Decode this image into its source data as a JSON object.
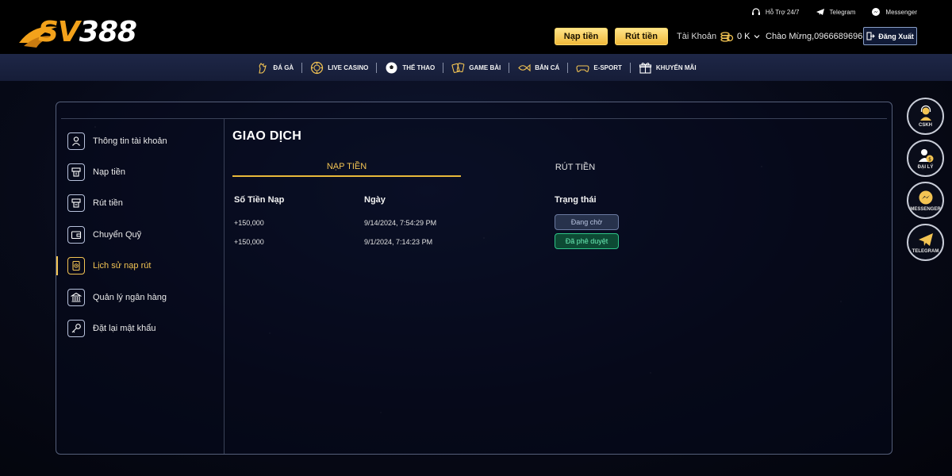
{
  "logo": {
    "text_sv": "SV",
    "text_num": "388"
  },
  "header": {
    "support_label": "Hỗ Trợ 24/7",
    "telegram_label": "Telegram",
    "messenger_label": "Messenger",
    "deposit_button": "Nạp tiền",
    "withdraw_button": "Rút tiền",
    "account_label": "Tài Khoản",
    "balance": "0 K",
    "welcome": "Chào Mừng,0966689696",
    "logout_button": "Đăng Xuất"
  },
  "nav": {
    "items": [
      {
        "label": "ĐÁ GÀ",
        "icon": "rooster-icon"
      },
      {
        "label": "LIVE CASINO",
        "icon": "chip-icon"
      },
      {
        "label": "THỂ THAO",
        "icon": "soccer-ball-icon"
      },
      {
        "label": "GAME BÀI",
        "icon": "cards-icon"
      },
      {
        "label": "BẮN CÁ",
        "icon": "fish-icon"
      },
      {
        "label": "E-SPORT",
        "icon": "gamepad-icon"
      },
      {
        "label": "KHUYẾN MÃI",
        "icon": "gift-icon"
      }
    ]
  },
  "sidebar": {
    "items": [
      {
        "label": "Thông tin tài khoản",
        "icon": "user-icon"
      },
      {
        "label": "Nạp tiền",
        "icon": "deposit-icon"
      },
      {
        "label": "Rút tiền",
        "icon": "withdraw-icon"
      },
      {
        "label": "Chuyển Quỹ",
        "icon": "wallet-icon"
      },
      {
        "label": "Lịch sử nạp rút",
        "icon": "history-icon"
      },
      {
        "label": "Quản lý ngân hàng",
        "icon": "bank-icon"
      },
      {
        "label": "Đặt lại mật khẩu",
        "icon": "key-icon"
      }
    ],
    "active_index": 4
  },
  "content": {
    "title": "GIAO DỊCH",
    "tabs": [
      {
        "label": "NẠP TIỀN",
        "active": true
      },
      {
        "label": "RÚT TIỀN",
        "active": false
      }
    ],
    "columns": [
      "Số Tiền Nạp",
      "Ngày",
      "Trạng thái"
    ],
    "rows": [
      {
        "amount": "+150,000",
        "date": "9/14/2024, 7:54:29 PM",
        "status": "Đang chờ"
      },
      {
        "amount": "+150,000",
        "date": "9/1/2024, 7:14:23 PM",
        "status": "Đã phê duyệt"
      }
    ]
  },
  "floating": {
    "cskh": "CSKH",
    "daily": "ĐẠI LÝ",
    "messenger": "MESSENGER",
    "telegram": "TELEGRAM"
  },
  "colors": {
    "accent_gold": "#f3c453",
    "approved_green": "#2ec487",
    "pending_gray": "#6b7aa0"
  }
}
